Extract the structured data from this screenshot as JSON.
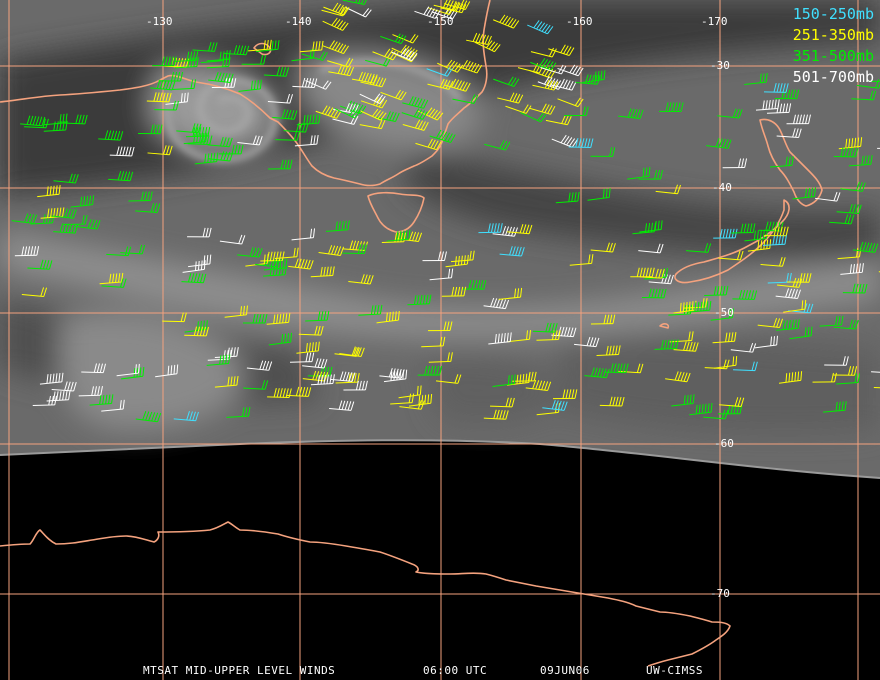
{
  "legend": [
    {
      "label": "150-250mb",
      "color": "#40e0ff"
    },
    {
      "label": "251-350mb",
      "color": "#ffff00"
    },
    {
      "label": "351-500mb",
      "color": "#00ee00"
    },
    {
      "label": "501-700mb",
      "color": "#ffffff"
    }
  ],
  "longitude_labels": [
    "-130",
    "-140",
    "-150",
    "-160",
    "-170"
  ],
  "latitude_labels": [
    "-30",
    "-40",
    "-50",
    "-60",
    "-70"
  ],
  "footer": {
    "product": "MTSAT MID-UPPER LEVEL WINDS",
    "time": "06:00 UTC",
    "date": "09JUN06",
    "source": "UW-CIMSS"
  },
  "colors": {
    "grid": "#f4a27e",
    "coast": "#f4a27e",
    "background": "#000000",
    "cloud_base": "#6e6e6e"
  }
}
